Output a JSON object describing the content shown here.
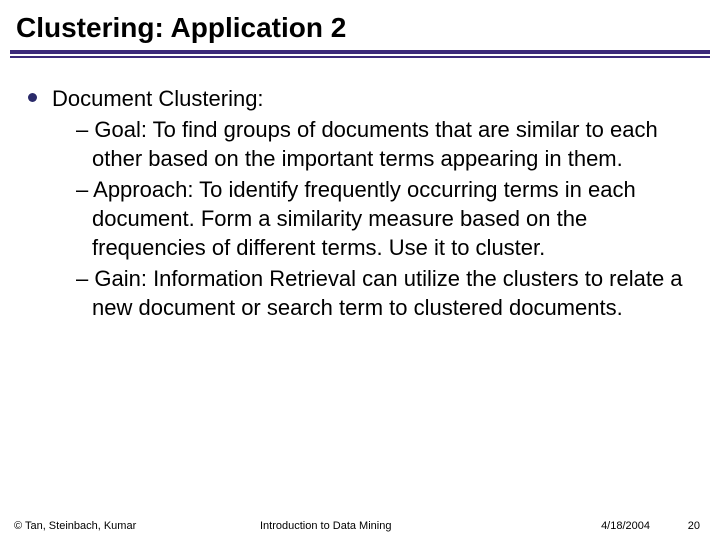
{
  "title": "Clustering: Application 2",
  "main_bullet": "Document Clustering:",
  "sub_items": [
    {
      "label": "Goal",
      "text": ": To find groups of documents that are similar to each other based on the important terms appearing in them."
    },
    {
      "label": "Approach",
      "text": ": To identify frequently occurring terms in each document. Form a similarity measure based on the frequencies of different terms. Use it to cluster."
    },
    {
      "label": "Gain",
      "text": ": Information Retrieval can utilize the clusters to relate a new document or search term to clustered documents."
    }
  ],
  "footer": {
    "copyright": "© Tan, Steinbach, Kumar",
    "course": "Introduction to Data Mining",
    "date": "4/18/2004",
    "page": "20"
  }
}
